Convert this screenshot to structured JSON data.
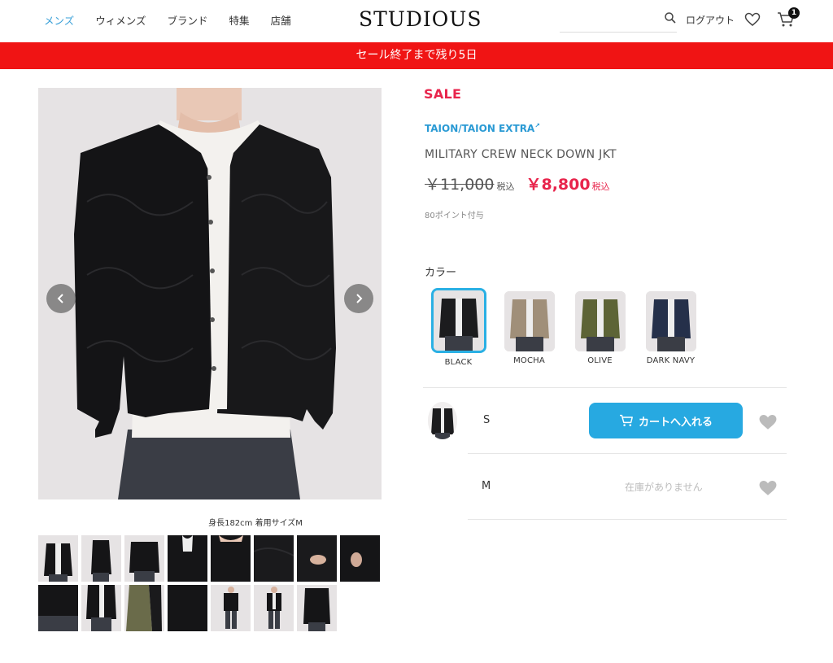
{
  "header": {
    "nav": [
      "メンズ",
      "ウィメンズ",
      "ブランド",
      "特集",
      "店舗"
    ],
    "logo": "STUDIOUS",
    "logout": "ログアウト",
    "cart_count": "1"
  },
  "banner": {
    "text": "セール終了まで残り5日"
  },
  "gallery": {
    "caption": "身長182cm 着用サイズM"
  },
  "product": {
    "sale_label": "SALE",
    "brand": "TAION/TAION EXTRA",
    "name": "MILITARY CREW NECK DOWN JKT",
    "price_old": "￥11,000",
    "tax_old": "税込",
    "price_new": "￥8,800",
    "tax_new": "税込",
    "points": "80ポイント付与",
    "color_label": "カラー",
    "colors": [
      {
        "name": "BLACK",
        "swatch": "#1c1c1e",
        "selected": true
      },
      {
        "name": "MOCHA",
        "swatch": "#a08f79",
        "selected": false
      },
      {
        "name": "OLIVE",
        "swatch": "#5d6436",
        "selected": false
      },
      {
        "name": "DARK NAVY",
        "swatch": "#25304a",
        "selected": false
      }
    ],
    "sizes": [
      {
        "label": "S",
        "action": "カートへ入れる"
      },
      {
        "label": "M",
        "status": "在庫がありません"
      }
    ]
  },
  "colors": {
    "accent_blue": "#27a9e1",
    "sale_red": "#e8254c",
    "banner_red": "#f01414"
  }
}
